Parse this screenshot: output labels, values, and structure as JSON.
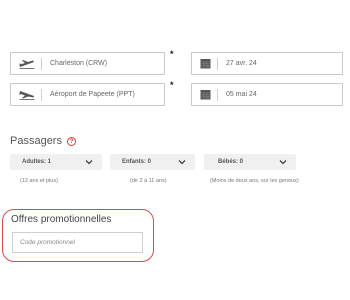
{
  "flights": [
    {
      "icon": "plane-takeoff-icon",
      "location": "Charleston (CRW)",
      "date": "27 avr. 24",
      "required": "*"
    },
    {
      "icon": "plane-landing-icon",
      "location": "Aéroport de Papeete (PPT)",
      "date": "05 mai 24",
      "required": "*"
    }
  ],
  "passengers": {
    "title": "Passagers",
    "help": "?",
    "adults": {
      "label": "Adultes: 1",
      "hint": "(12 ans et plus)"
    },
    "children": {
      "label": "Enfants: 0",
      "hint": "(de 2 à 11 ans)"
    },
    "infants": {
      "label": "Bébés: 0",
      "hint": "(Moins de deux ans, sur les genoux)"
    }
  },
  "promo": {
    "title": "Offres promotionnelles",
    "placeholder": "Code promotionnel"
  },
  "colors": {
    "accent": "#d84a4a",
    "help": "#e03b3b",
    "border": "#c9c9c9"
  }
}
